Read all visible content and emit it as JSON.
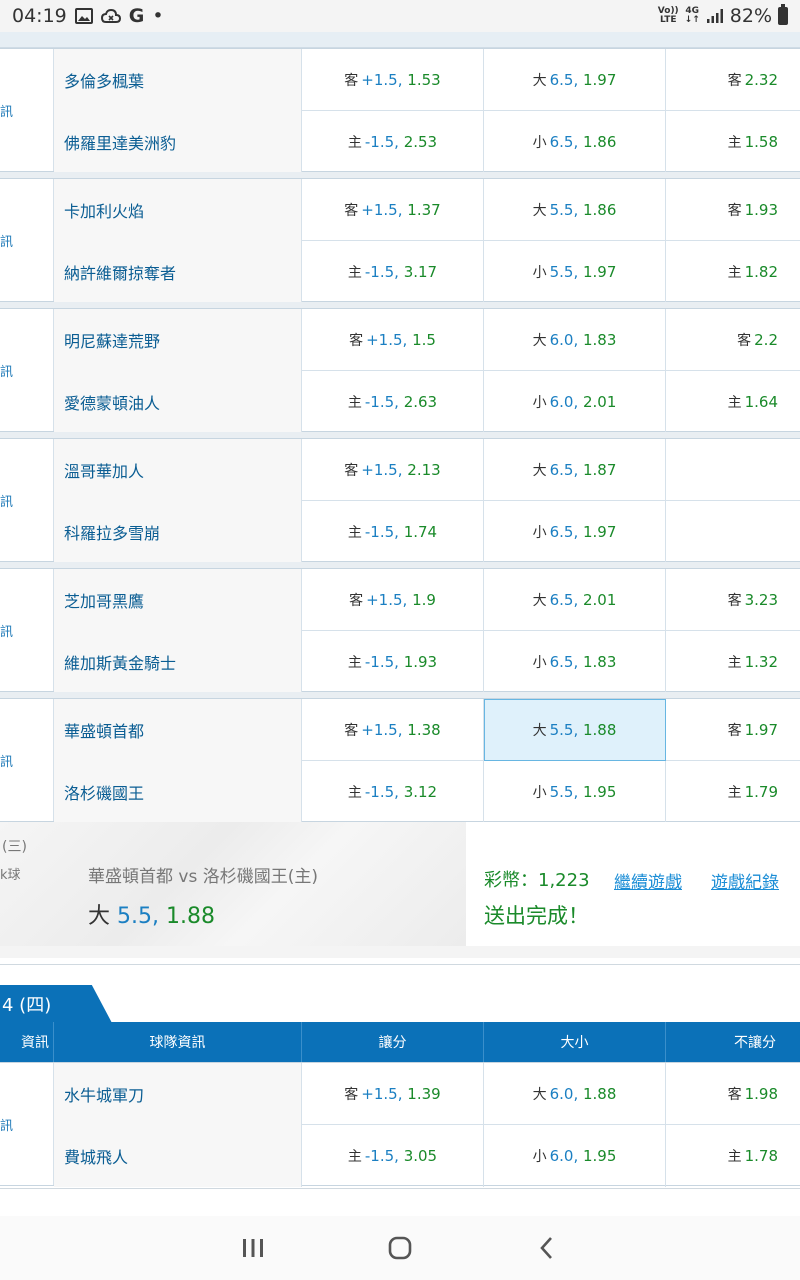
{
  "status_bar": {
    "time": "04:19",
    "left_icons": [
      "image-icon",
      "cloud-icon",
      "google-icon",
      "dot-icon"
    ],
    "g_glyph": "G",
    "dot_glyph": "•",
    "volte": [
      "Vo))",
      "LTE"
    ],
    "network": "4G",
    "battery_percent": "82%"
  },
  "groups": [
    {
      "info": "訊",
      "rows": [
        {
          "team": "多倫多楓葉",
          "hc_label": "客",
          "hc_line": "+1.5,",
          "hc_odd": "1.53",
          "ou_label": "大",
          "ou_line": "6.5,",
          "ou_odd": "1.97",
          "ml_label": "客",
          "ml_odd": "2.32"
        },
        {
          "team": "佛羅里達美洲豹",
          "hc_label": "主",
          "hc_line": "-1.5,",
          "hc_odd": "2.53",
          "ou_label": "小",
          "ou_line": "6.5,",
          "ou_odd": "1.86",
          "ml_label": "主",
          "ml_odd": "1.58"
        }
      ]
    },
    {
      "info": "訊",
      "rows": [
        {
          "team": "卡加利火焰",
          "hc_label": "客",
          "hc_line": "+1.5,",
          "hc_odd": "1.37",
          "ou_label": "大",
          "ou_line": "5.5,",
          "ou_odd": "1.86",
          "ml_label": "客",
          "ml_odd": "1.93"
        },
        {
          "team": "納許維爾掠奪者",
          "hc_label": "主",
          "hc_line": "-1.5,",
          "hc_odd": "3.17",
          "ou_label": "小",
          "ou_line": "5.5,",
          "ou_odd": "1.97",
          "ml_label": "主",
          "ml_odd": "1.82"
        }
      ]
    },
    {
      "info": "訊",
      "rows": [
        {
          "team": "明尼蘇達荒野",
          "hc_label": "客",
          "hc_line": "+1.5,",
          "hc_odd": "1.5",
          "ou_label": "大",
          "ou_line": "6.0,",
          "ou_odd": "1.83",
          "ml_label": "客",
          "ml_odd": "2.2"
        },
        {
          "team": "愛德蒙頓油人",
          "hc_label": "主",
          "hc_line": "-1.5,",
          "hc_odd": "2.63",
          "ou_label": "小",
          "ou_line": "6.0,",
          "ou_odd": "2.01",
          "ml_label": "主",
          "ml_odd": "1.64"
        }
      ]
    },
    {
      "info": "訊",
      "rows": [
        {
          "team": "溫哥華加人",
          "hc_label": "客",
          "hc_line": "+1.5,",
          "hc_odd": "2.13",
          "ou_label": "大",
          "ou_line": "6.5,",
          "ou_odd": "1.87",
          "ml_label": "",
          "ml_odd": ""
        },
        {
          "team": "科羅拉多雪崩",
          "hc_label": "主",
          "hc_line": "-1.5,",
          "hc_odd": "1.74",
          "ou_label": "小",
          "ou_line": "6.5,",
          "ou_odd": "1.97",
          "ml_label": "",
          "ml_odd": ""
        }
      ]
    },
    {
      "info": "訊",
      "rows": [
        {
          "team": "芝加哥黑鷹",
          "hc_label": "客",
          "hc_line": "+1.5,",
          "hc_odd": "1.9",
          "ou_label": "大",
          "ou_line": "6.5,",
          "ou_odd": "2.01",
          "ml_label": "客",
          "ml_odd": "3.23"
        },
        {
          "team": "維加斯黃金騎士",
          "hc_label": "主",
          "hc_line": "-1.5,",
          "hc_odd": "1.93",
          "ou_label": "小",
          "ou_line": "6.5,",
          "ou_odd": "1.83",
          "ml_label": "主",
          "ml_odd": "1.32"
        }
      ]
    },
    {
      "info": "訊",
      "rows": [
        {
          "team": "華盛頓首都",
          "hc_label": "客",
          "hc_line": "+1.5,",
          "hc_odd": "1.38",
          "ou_label": "大",
          "ou_line": "5.5,",
          "ou_odd": "1.88",
          "ml_label": "客",
          "ml_odd": "1.97",
          "ou_selected": true
        },
        {
          "team": "洛杉磯國王",
          "hc_label": "主",
          "hc_line": "-1.5,",
          "hc_odd": "3.12",
          "ou_label": "小",
          "ou_line": "5.5,",
          "ou_odd": "1.95",
          "ml_label": "主",
          "ml_odd": "1.79"
        }
      ]
    }
  ],
  "bet": {
    "date": "(三)",
    "sport": "k球",
    "match": "華盛頓首都 vs 洛杉磯國王(主)",
    "pick_label": "大",
    "pick_line": "5.5,",
    "pick_odd": "1.88",
    "coins": "彩幣：1,223",
    "done": "送出完成！",
    "continue_link": "繼續遊戲",
    "history_link": "遊戲紀錄"
  },
  "next_day": {
    "tab_label": "4 (四)",
    "headers": [
      "資訊",
      "球隊資訊",
      "讓分",
      "大小",
      "不讓分"
    ],
    "group": {
      "info": "訊",
      "rows": [
        {
          "team": "水牛城軍刀",
          "hc_label": "客",
          "hc_line": "+1.5,",
          "hc_odd": "1.39",
          "ou_label": "大",
          "ou_line": "6.0,",
          "ou_odd": "1.88",
          "ml_label": "客",
          "ml_odd": "1.98"
        },
        {
          "team": "費城飛人",
          "hc_label": "主",
          "hc_line": "-1.5,",
          "hc_odd": "3.05",
          "ou_label": "小",
          "ou_line": "6.0,",
          "ou_odd": "1.95",
          "ml_label": "主",
          "ml_odd": "1.78"
        }
      ]
    }
  },
  "colors": {
    "header_blue": "#0b71b8",
    "team_blue": "#0a5d93",
    "number_blue": "#1b7fc2",
    "odd_green": "#1a8a2a",
    "selected_bg": "#dff1fb"
  }
}
